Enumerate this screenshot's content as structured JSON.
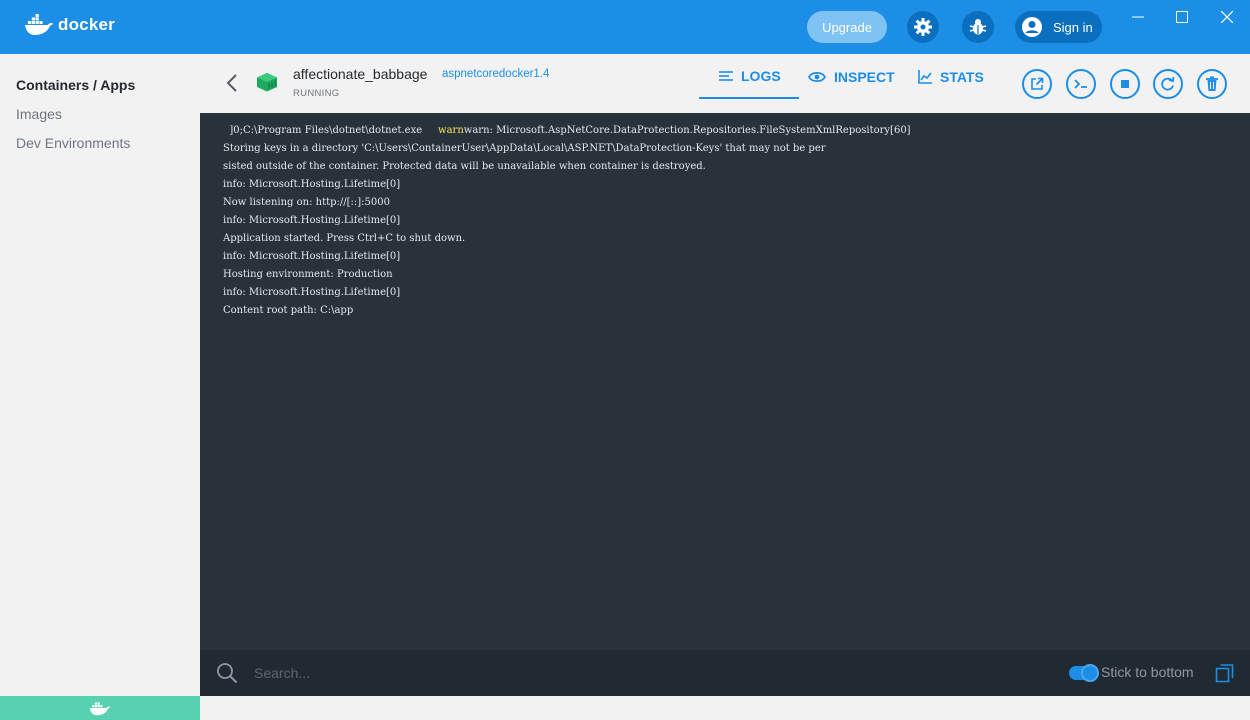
{
  "app": {
    "logo_text": "docker",
    "upgrade_label": "Upgrade",
    "signin_label": "Sign in",
    "colors": {
      "titlebar": "#1d8ee6",
      "accent": "#1d8ee6",
      "running": "#1eaa5f",
      "warn": "#ffe65c",
      "log_bg": "#27323b"
    }
  },
  "sidebar": {
    "items": [
      {
        "label": "Containers / Apps"
      },
      {
        "label": "Images"
      },
      {
        "label": "Dev Environments"
      }
    ]
  },
  "container": {
    "name": "affectionate_babbage",
    "image": "aspnetcoredocker1.4",
    "status": "RUNNING"
  },
  "tabs": [
    {
      "label": "LOGS",
      "icon": "lines-icon"
    },
    {
      "label": "INSPECT",
      "icon": "eye-icon"
    },
    {
      "label": "STATS",
      "icon": "chart-icon"
    }
  ],
  "actions": [
    "open-browser-icon",
    "cli-icon",
    "stop-icon",
    "restart-icon",
    "delete-icon"
  ],
  "logs": {
    "first_prefix": "  ]0;C:\\Program Files\\dotnet\\dotnet.exe     ",
    "first_warn": "warn",
    "first_rest": "warn: Microsoft.AspNetCore.DataProtection.Repositories.FileSystemXmlRepository[60]",
    "lines": [
      "Storing keys in a directory 'C:\\Users\\ContainerUser\\AppData\\Local\\ASP.NET\\DataProtection-Keys' that may not be per",
      "sisted outside of the container. Protected data will be unavailable when container is destroyed.",
      "info: Microsoft.Hosting.Lifetime[0]",
      "Now listening on: http://[::]:5000",
      "info: Microsoft.Hosting.Lifetime[0]",
      "Application started. Press Ctrl+C to shut down.",
      "info: Microsoft.Hosting.Lifetime[0]",
      "Hosting environment: Production",
      "info: Microsoft.Hosting.Lifetime[0]",
      "Content root path: C:\\app"
    ]
  },
  "search": {
    "placeholder": "Search..."
  },
  "stick_to_bottom": {
    "label": "Stick to bottom",
    "enabled": true
  }
}
